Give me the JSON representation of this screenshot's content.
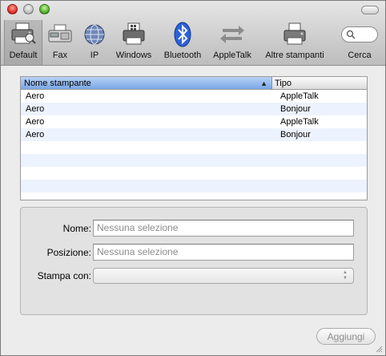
{
  "toolbar": {
    "items": [
      {
        "label": "Default",
        "icon": "printer-default-icon"
      },
      {
        "label": "Fax",
        "icon": "fax-icon"
      },
      {
        "label": "IP",
        "icon": "globe-icon"
      },
      {
        "label": "Windows",
        "icon": "windows-printer-icon"
      },
      {
        "label": "Bluetooth",
        "icon": "bluetooth-icon"
      },
      {
        "label": "AppleTalk",
        "icon": "appletalk-arrows-icon"
      },
      {
        "label": "Altre stampanti",
        "icon": "printer-icon"
      },
      {
        "label": "Cerca",
        "icon": "search-icon"
      }
    ],
    "active_item": "Default"
  },
  "list": {
    "columns": [
      "Nome stampante",
      "Tipo"
    ],
    "sort_column": "Nome stampante",
    "rows": [
      {
        "name": "Aero",
        "type": "AppleTalk"
      },
      {
        "name": "Aero",
        "type": "Bonjour"
      },
      {
        "name": "Aero",
        "type": "AppleTalk"
      },
      {
        "name": "Aero",
        "type": "Bonjour"
      }
    ]
  },
  "details": {
    "name_label": "Nome:",
    "name_placeholder": "Nessuna selezione",
    "location_label": "Posizione:",
    "location_placeholder": "Nessuna selezione",
    "print_using_label": "Stampa con:",
    "print_using_value": ""
  },
  "actions": {
    "add_label": "Aggiungi"
  },
  "colors": {
    "header_selected": "#7ba7e6",
    "row_alternate": "#edf3fe"
  }
}
